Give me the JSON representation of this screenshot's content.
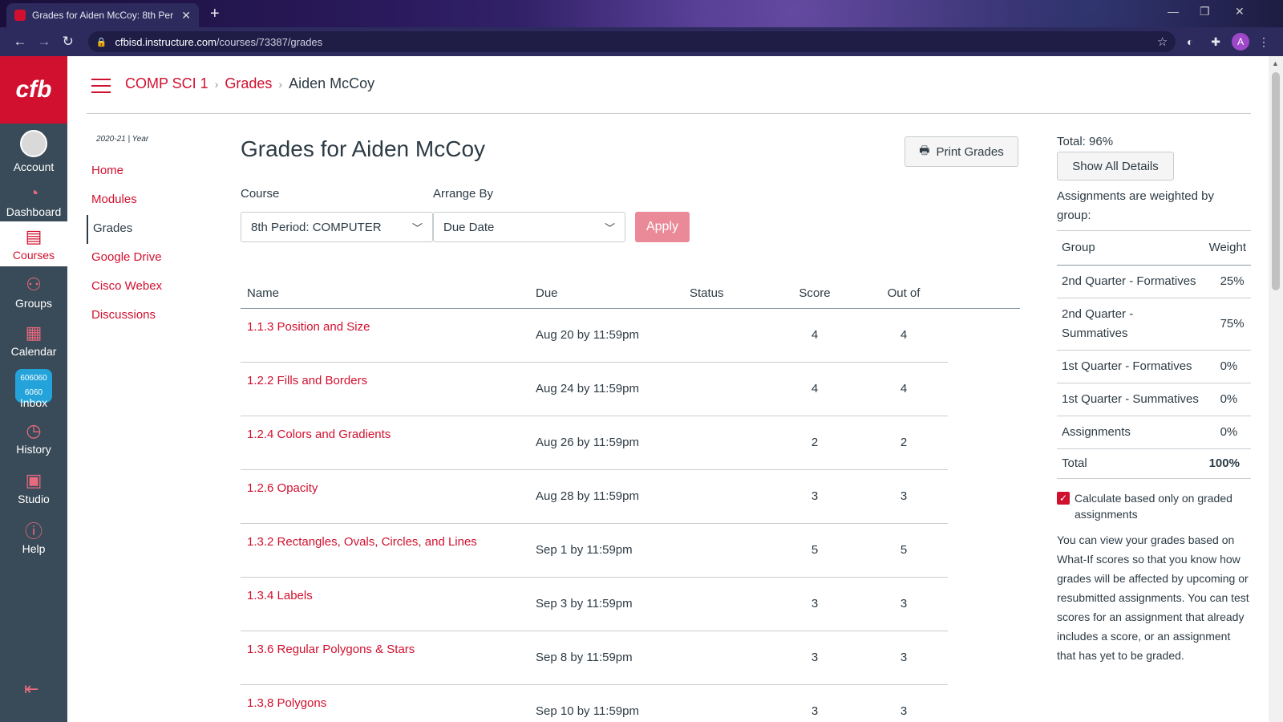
{
  "browser": {
    "tab_title": "Grades for Aiden McCoy: 8th Per",
    "url_host": "cfbisd.instructure.com",
    "url_path": "/courses/73387/grades",
    "profile_initial": "A"
  },
  "global_nav": {
    "logo": "cfb",
    "items": [
      {
        "label": "Account"
      },
      {
        "label": "Dashboard"
      },
      {
        "label": "Courses"
      },
      {
        "label": "Groups"
      },
      {
        "label": "Calendar"
      },
      {
        "label": "Inbox",
        "badge_line1": "606060",
        "badge_line2": "6060"
      },
      {
        "label": "History"
      },
      {
        "label": "Studio"
      },
      {
        "label": "Help"
      }
    ]
  },
  "breadcrumb": [
    "COMP SCI 1",
    "Grades",
    "Aiden McCoy"
  ],
  "course_nav": {
    "year": "2020-21 | Year",
    "items": [
      "Home",
      "Modules",
      "Grades",
      "Google Drive",
      "Cisco Webex",
      "Discussions"
    ]
  },
  "main": {
    "title": "Grades for Aiden McCoy",
    "print_label": "Print Grades",
    "course_label": "Course",
    "course_value": "8th Period: COMPUTER",
    "arrange_label": "Arrange By",
    "arrange_value": "Due Date",
    "apply_label": "Apply",
    "columns": [
      "Name",
      "Due",
      "Status",
      "Score",
      "Out of"
    ],
    "rows": [
      {
        "name": "1.1.3 Position and Size",
        "due": "Aug 20 by 11:59pm",
        "score": "4",
        "out_of": "4"
      },
      {
        "name": "1.2.2 Fills and Borders",
        "due": "Aug 24 by 11:59pm",
        "score": "4",
        "out_of": "4"
      },
      {
        "name": "1.2.4 Colors and Gradients",
        "due": "Aug 26 by 11:59pm",
        "score": "2",
        "out_of": "2"
      },
      {
        "name": "1.2.6 Opacity",
        "due": "Aug 28 by 11:59pm",
        "score": "3",
        "out_of": "3"
      },
      {
        "name": "1.3.2 Rectangles, Ovals, Circles, and Lines",
        "due": "Sep 1 by 11:59pm",
        "score": "5",
        "out_of": "5"
      },
      {
        "name": "1.3.4 Labels",
        "due": "Sep 3 by 11:59pm",
        "score": "3",
        "out_of": "3"
      },
      {
        "name": "1.3.6 Regular Polygons & Stars",
        "due": "Sep 8 by 11:59pm",
        "score": "3",
        "out_of": "3"
      },
      {
        "name": "1.3,8 Polygons",
        "due": "Sep 10 by 11:59pm",
        "score": "3",
        "out_of": "3"
      }
    ]
  },
  "sidebar": {
    "total": "Total: 96%",
    "show_all_label": "Show All Details",
    "weighted_note": "Assignments are weighted by group:",
    "weight_header_group": "Group",
    "weight_header_weight": "Weight",
    "weights": [
      {
        "group": "2nd Quarter - Formatives",
        "weight": "25%"
      },
      {
        "group": "2nd Quarter - Summatives",
        "weight": "75%"
      },
      {
        "group": "1st Quarter - Formatives",
        "weight": "0%"
      },
      {
        "group": "1st Quarter - Summatives",
        "weight": "0%"
      },
      {
        "group": "Assignments",
        "weight": "0%"
      }
    ],
    "weights_total_label": "Total",
    "weights_total_value": "100%",
    "calc_label": "Calculate based only on graded assignments",
    "whatif_text": "You can view your grades based on What-If scores so that you know how grades will be affected by upcoming or resubmitted assignments. You can test scores for an assignment that already includes a score, or an assignment that has yet to be graded."
  },
  "colors": {
    "brand": "#d1102f",
    "nav_bg": "#394b58",
    "apply_disabled": "#ea8a99",
    "inbox_badge": "#23a3d9"
  }
}
